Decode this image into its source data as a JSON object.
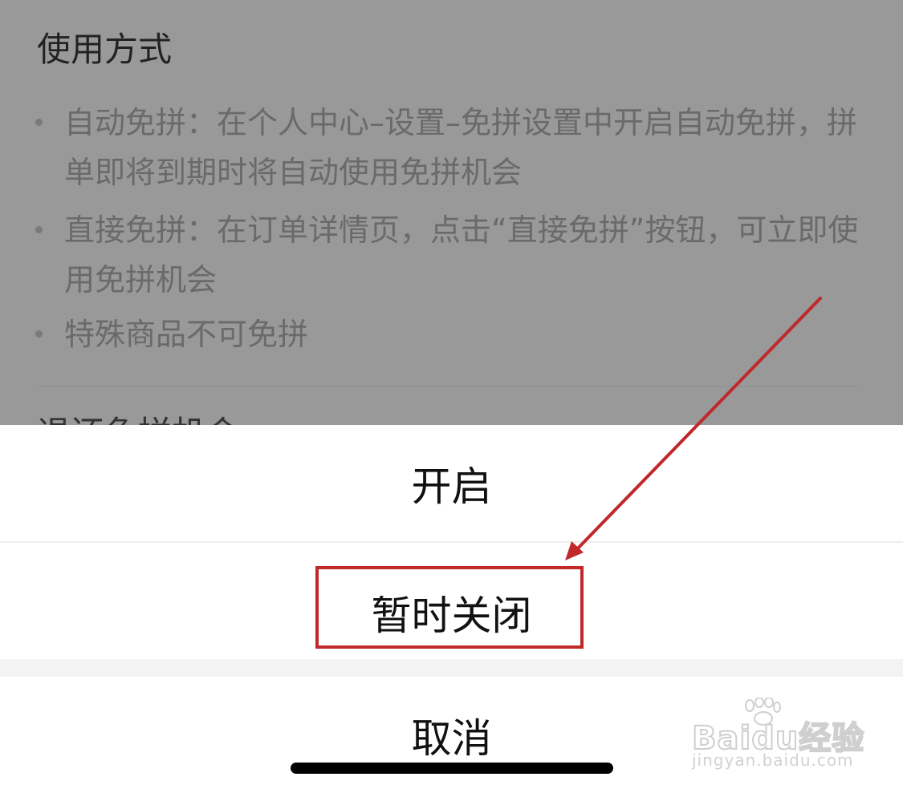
{
  "background": {
    "section_title": "使用方式",
    "bullets": [
      "自动免拼：在个人中心–设置–免拼设置中开启自动免拼，拼单即将到期时将自动使用免拼机会",
      "直接免拼：在订单详情页，点击“直接免拼”按钮，可立即使用免拼机会",
      "特殊商品不可免拼"
    ],
    "next_section_title": "退还免拼机会"
  },
  "action_sheet": {
    "open_label": "开启",
    "close_temporarily_label": "暂时关闭",
    "cancel_label": "取消"
  },
  "annotation": {
    "color": "#c0282a"
  },
  "watermark": {
    "logo_text": "Baidu经验",
    "url_text": "jingyan.baidu.com"
  },
  "colors": {
    "overlay": "#999999",
    "sheet": "#ffffff",
    "accent": "#c0282a"
  }
}
